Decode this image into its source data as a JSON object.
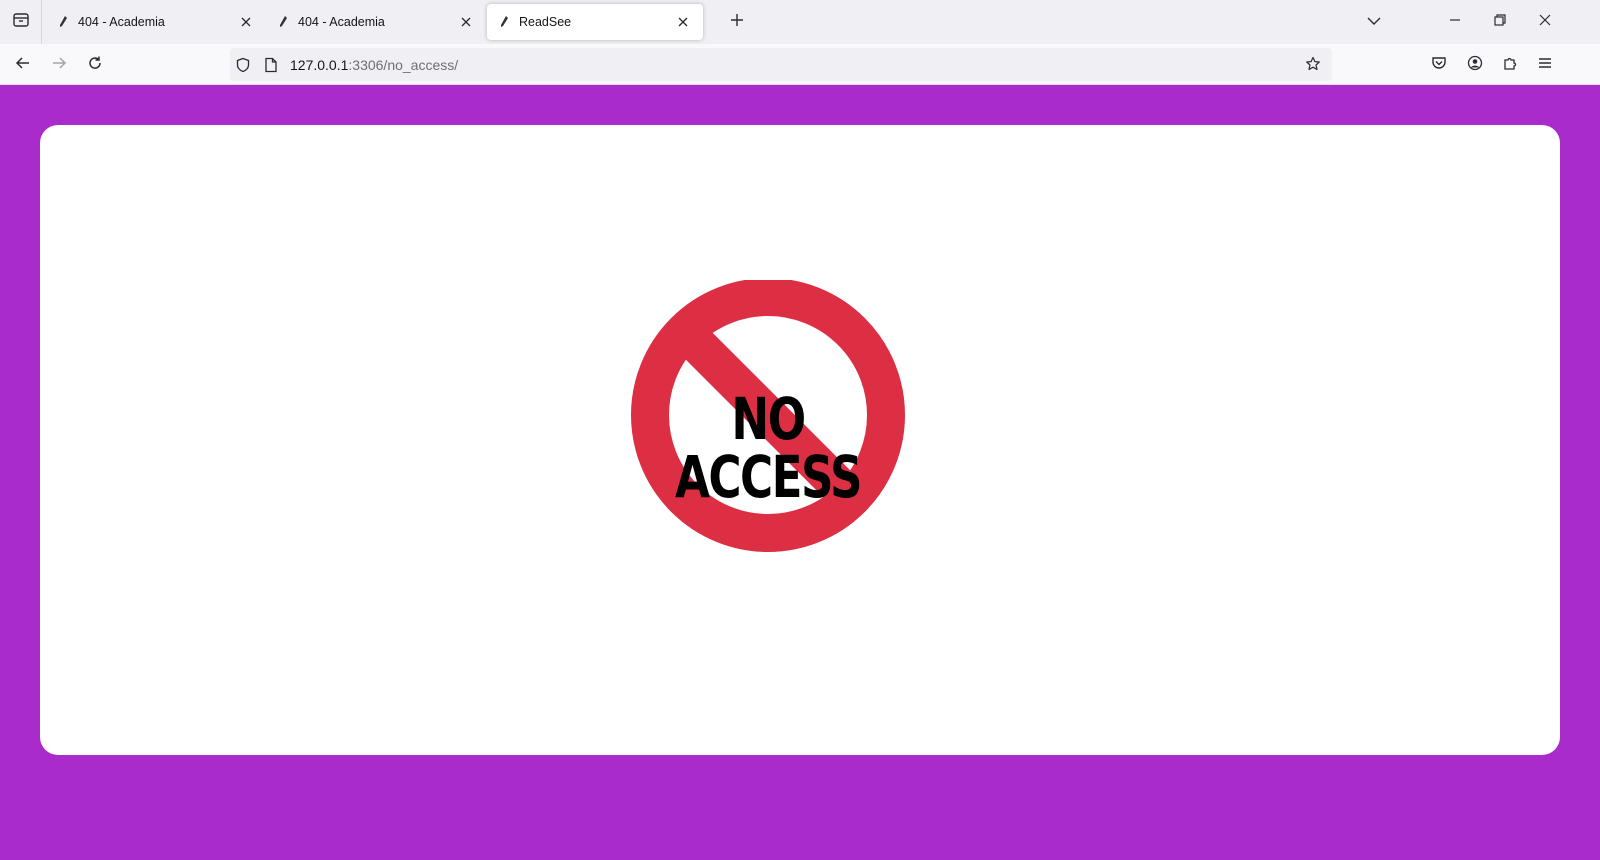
{
  "browser": {
    "tabs": [
      {
        "title": "404 - Academia",
        "active": false
      },
      {
        "title": "404 - Academia",
        "active": false
      },
      {
        "title": "ReadSee",
        "active": true
      }
    ],
    "url": {
      "host": "127.0.0.1",
      "rest": ":3306/no_access/"
    }
  },
  "page": {
    "background_color": "#a92bc9",
    "sign_color": "#dc2f44",
    "no_access_text": "NO ACCESS"
  }
}
